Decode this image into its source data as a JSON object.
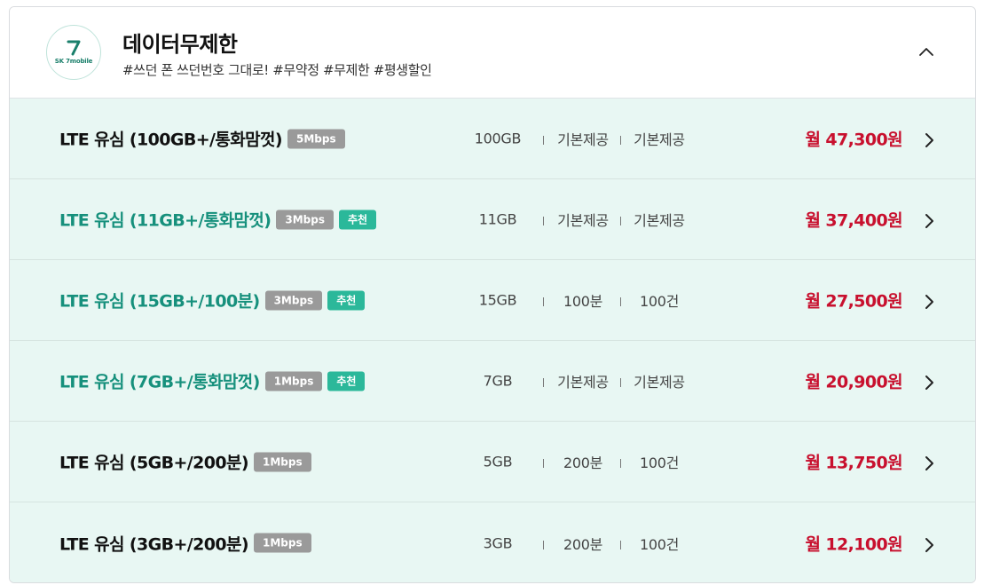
{
  "header": {
    "logo_text": "SK 7mobile",
    "title": "데이터무제한",
    "hashtags": "#쓰던 폰 쓰던번호 그대로! #무약정 #무제한 #평생할인"
  },
  "plans": [
    {
      "name": "LTE 유심 (100GB+/통화맘껏)",
      "speed": "5Mbps",
      "recommend": "",
      "data": "100GB",
      "voice": "기본제공",
      "sms": "기본제공",
      "price": "월 47,300원",
      "highlight": false
    },
    {
      "name": "LTE 유심 (11GB+/통화맘껏)",
      "speed": "3Mbps",
      "recommend": "추천",
      "data": "11GB",
      "voice": "기본제공",
      "sms": "기본제공",
      "price": "월 37,400원",
      "highlight": true
    },
    {
      "name": "LTE 유심 (15GB+/100분)",
      "speed": "3Mbps",
      "recommend": "추천",
      "data": "15GB",
      "voice": "100분",
      "sms": "100건",
      "price": "월 27,500원",
      "highlight": true
    },
    {
      "name": "LTE 유심 (7GB+/통화맘껏)",
      "speed": "1Mbps",
      "recommend": "추천",
      "data": "7GB",
      "voice": "기본제공",
      "sms": "기본제공",
      "price": "월 20,900원",
      "highlight": true
    },
    {
      "name": "LTE 유심 (5GB+/200분)",
      "speed": "1Mbps",
      "recommend": "",
      "data": "5GB",
      "voice": "200분",
      "sms": "100건",
      "price": "월 13,750원",
      "highlight": false
    },
    {
      "name": "LTE 유심 (3GB+/200분)",
      "speed": "1Mbps",
      "recommend": "",
      "data": "3GB",
      "voice": "200분",
      "sms": "100건",
      "price": "월 12,100원",
      "highlight": false
    }
  ],
  "colors": {
    "accent": "#16907c",
    "price": "#c8102e",
    "row_bg": "#e8f7f3",
    "speed_badge": "#9a9a9a",
    "recommend_badge": "#2bb89a"
  },
  "icons": {
    "collapse": "chevron-up-icon",
    "row_arrow": "chevron-right-icon"
  }
}
